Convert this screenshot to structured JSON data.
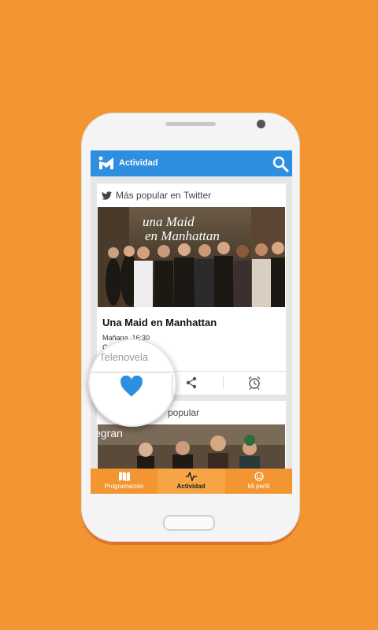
{
  "appbar": {
    "title": "Actividad",
    "search_icon": "search-icon",
    "logo_icon": "app-logo-icon",
    "color": "#2E8FE0"
  },
  "card1": {
    "heading": "Más popular en Twitter",
    "heading_icon": "twitter-icon",
    "image_caption": "Una Maid en Manhattan",
    "show_title": "Una Maid en Manhattan",
    "show_time": "Mañana, 16:30",
    "show_channel": "C",
    "actions": [
      "heart-icon",
      "share-icon",
      "alarm-icon"
    ]
  },
  "card2": {
    "heading": "popular",
    "heading_prefix": "egran"
  },
  "magnifier": {
    "text": "Telenovela",
    "icon": "heart-icon",
    "accent": "#2E8FE0"
  },
  "bottomnav": {
    "items": [
      {
        "label": "Programación",
        "icon": "map-icon"
      },
      {
        "label": "Actividad",
        "icon": "activity-icon"
      },
      {
        "label": "Mi perfil",
        "icon": "profile-icon"
      }
    ],
    "active_index": 1,
    "color": "#F39530"
  },
  "colors": {
    "background": "#F39530"
  }
}
